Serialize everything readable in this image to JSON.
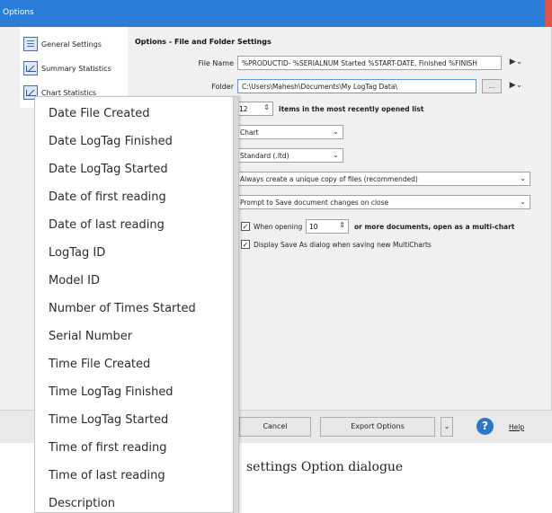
{
  "window": {
    "title": "Options"
  },
  "nav": {
    "items": [
      {
        "label": "General Settings",
        "icon": "settings-doc-icon"
      },
      {
        "label": "Summary Statistics",
        "icon": "statistics-chart-icon"
      },
      {
        "label": "Chart Statistics",
        "icon": "chart-icon"
      }
    ]
  },
  "panel": {
    "title": "Options - File and Folder Settings",
    "file_name": {
      "label": "File Name",
      "value": "%PRODUCTID- %SERIALNUM Started %START-DATE, Finished %FINISH"
    },
    "folder": {
      "label": "Folder",
      "value": "C:\\Users\\Mahesh\\Documents\\My LogTag Data\\",
      "browse_label": "..."
    },
    "recent": {
      "value": "12",
      "suffix": "items in the most recently opened list"
    },
    "select_view": "Chart",
    "select_format": "Standard (.ltd)",
    "select_copy": "Always create a unique copy of files (recommended)",
    "select_save": "Prompt to Save document changes on close",
    "multichart": {
      "prefix": "When opening",
      "value": "10",
      "suffix": "or more documents, open as a multi-chart"
    },
    "save_as": {
      "label": "Display Save As dialog when saving new MultiCharts"
    }
  },
  "buttons": {
    "cancel": "Cancel",
    "export": "Export Options",
    "help": "Help",
    "help_icon_glyph": "?"
  },
  "caption": "settings Option dialogue",
  "dropdown": {
    "items": [
      "Date File Created",
      "Date LogTag Finished",
      "Date LogTag Started",
      "Date of first reading",
      "Date of last reading",
      "LogTag ID",
      "Model ID",
      "Number of Times Started",
      "Serial Number",
      "Time File Created",
      "Time LogTag Finished",
      "Time LogTag Started",
      "Time of first reading",
      "Time of last reading",
      "Description"
    ]
  },
  "colors": {
    "titlebar": "#2b7bd8",
    "accent": "#2a78c8",
    "close": "#e0524a"
  }
}
